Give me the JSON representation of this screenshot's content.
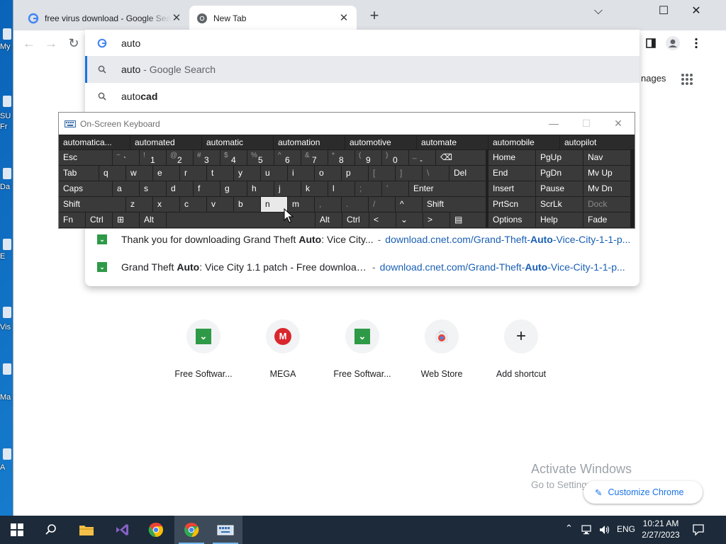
{
  "desktop": {
    "icon_labels": [
      "My",
      "SU",
      "Fr",
      "Da",
      "E",
      "Vis",
      "Ma",
      "A"
    ]
  },
  "tabs": [
    {
      "title": "free virus download - Google Sea",
      "close": "✕"
    },
    {
      "title": "New Tab",
      "close": "✕"
    }
  ],
  "new_tab": "+",
  "window_controls": {
    "minimize": "⌵",
    "maximize": "☐",
    "close": "✕"
  },
  "omnibox": {
    "query": "auto",
    "suggestions": [
      {
        "typed": "auto",
        "rest": " - Google Search",
        "kind": "search"
      },
      {
        "typed": "auto",
        "bold": "cad",
        "kind": "search"
      }
    ],
    "history": [
      {
        "pre": "Thank you for downloading Grand Theft ",
        "bold": "Auto",
        "post": ": Vice City...",
        "sep": "-",
        "url_pre": "download.cnet.com/Grand-Theft-",
        "url_bold": "Auto",
        "url_post": "-Vice-City-1-1-p..."
      },
      {
        "pre": "Grand Theft ",
        "bold": "Auto",
        "post": ": Vice City 1.1 patch - Free download...",
        "sep": "-",
        "url_pre": "download.cnet.com/Grand-Theft-",
        "url_bold": "Auto",
        "url_post": "-Vice-City-1-1-p..."
      }
    ]
  },
  "page": {
    "images_link": "nages",
    "shortcuts": [
      {
        "label": "Free Softwar...",
        "icon": "cnet-icon"
      },
      {
        "label": "MEGA",
        "icon": "mega-icon"
      },
      {
        "label": "Free Softwar...",
        "icon": "cnet-icon"
      },
      {
        "label": "Web Store",
        "icon": "webstore-icon"
      },
      {
        "label": "Add shortcut",
        "icon": "plus-icon"
      }
    ],
    "watermark_line1": "Activate Windows",
    "watermark_line2": "Go to Settings to activate Windows.",
    "customize": "Customize Chrome"
  },
  "osk": {
    "title": "On-Screen Keyboard",
    "predictions": [
      "automatica...",
      "automated",
      "automatic",
      "automation",
      "automotive",
      "automate",
      "automobile",
      "autopilot"
    ],
    "row1": [
      {
        "main": "Esc"
      },
      {
        "sm": "~",
        "mn": "`"
      },
      {
        "sm": "!",
        "mn": "1"
      },
      {
        "sm": "@",
        "mn": "2"
      },
      {
        "sm": "#",
        "mn": "3"
      },
      {
        "sm": "$",
        "mn": "4"
      },
      {
        "sm": "%",
        "mn": "5"
      },
      {
        "sm": "^",
        "mn": "6"
      },
      {
        "sm": "&",
        "mn": "7"
      },
      {
        "sm": "*",
        "mn": "8"
      },
      {
        "sm": "(",
        "mn": "9"
      },
      {
        "sm": ")",
        "mn": "0"
      },
      {
        "sm": "_",
        "mn": "-"
      },
      {
        "sm": "+",
        "mn": "="
      },
      {
        "main": "⌫"
      }
    ],
    "row2": [
      "Tab",
      "q",
      "w",
      "e",
      "r",
      "t",
      "y",
      "u",
      "i",
      "o",
      "p",
      "[",
      "]",
      "\\",
      "Del"
    ],
    "row3": [
      "Caps",
      "a",
      "s",
      "d",
      "f",
      "g",
      "h",
      "j",
      "k",
      "l",
      ";",
      "'",
      "Enter"
    ],
    "row4": [
      "Shift",
      "z",
      "x",
      "c",
      "v",
      "b",
      "n",
      "m",
      ",",
      ".",
      "/",
      "^",
      "Shift"
    ],
    "row5": [
      "Fn",
      "Ctrl",
      "⊞",
      "Alt",
      "",
      "Alt",
      "Ctrl",
      "<",
      "⌄",
      ">",
      "▤"
    ],
    "nav": [
      [
        "Home",
        "PgUp",
        "Nav"
      ],
      [
        "End",
        "PgDn",
        "Mv Up"
      ],
      [
        "Insert",
        "Pause",
        "Mv Dn"
      ],
      [
        "PrtScn",
        "ScrLk",
        "Dock"
      ],
      [
        "Options",
        "Help",
        "Fade"
      ]
    ],
    "highlighted_key": "n"
  },
  "taskbar": {
    "lang": "ENG",
    "time": "10:21 AM",
    "date": "2/27/2023"
  }
}
